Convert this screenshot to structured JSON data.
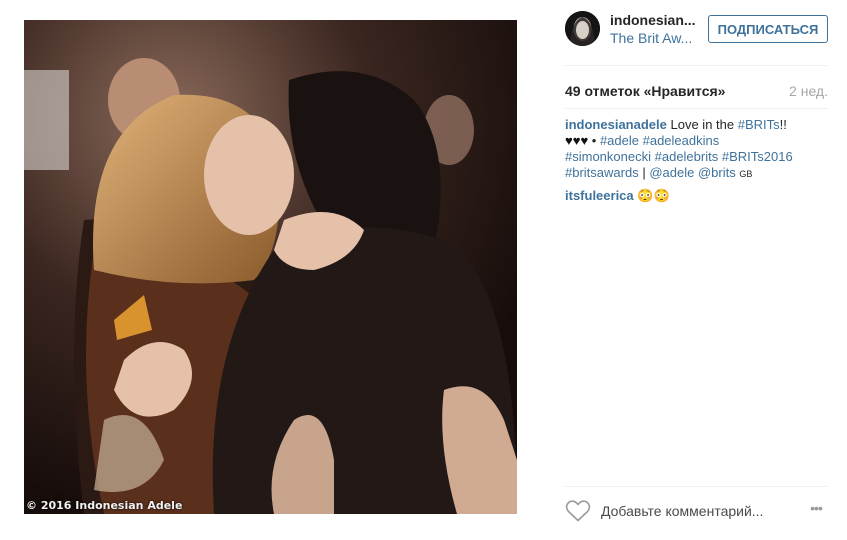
{
  "post": {
    "watermark": "© 2016 Indonesian Adele"
  },
  "header": {
    "username": "indonesian...",
    "location": "The Brit Aw...",
    "follow_label": "ПОДПИСАТЬСЯ"
  },
  "stats": {
    "likes": "49 отметок «Нравится»",
    "time": "2 нед."
  },
  "caption": {
    "user": "indonesianadele",
    "text_prefix": "Love in the ",
    "tag_brits": "#BRITs",
    "text_suffix": "!!",
    "hearts": "♥♥♥",
    "dot": " • ",
    "tag_adele": "#adele",
    "tag_adeleadkins": "#adeleadkins",
    "tag_simonkonecki": "#simonkonecki",
    "tag_adelebrits": "#adelebrits",
    "tag_brits2016": "#BRITs2016",
    "tag_britsawards": "#britsawards",
    "separator": " | ",
    "mention_adele": "@adele",
    "mention_brits": "@brits",
    "gb": "GB"
  },
  "comments": [
    {
      "user": "itsfuleerica",
      "text": "😳😳"
    }
  ],
  "footer": {
    "comment_placeholder": "Добавьте комментарий...",
    "more_label": "•••"
  },
  "colors": {
    "link_blue": "#3f729b",
    "text": "#262626",
    "muted": "#a5a7aa"
  }
}
